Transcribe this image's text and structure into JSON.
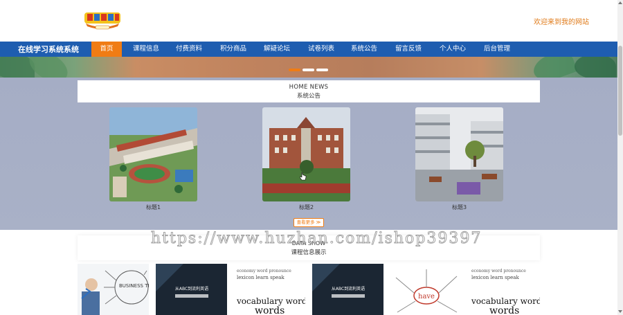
{
  "header": {
    "welcome": "欢迎来到我的网站"
  },
  "nav": {
    "brand": "在线学习系统系统",
    "items": [
      "首页",
      "课程信息",
      "付费资料",
      "积分商品",
      "解疑论坛",
      "试卷列表",
      "系统公告",
      "留言反馈",
      "个人中心",
      "后台管理"
    ],
    "active_index": 0
  },
  "banner": {
    "slides": 3,
    "active_slide": 0
  },
  "news": {
    "title_en": "HOME NEWS",
    "title_cn": "系统公告",
    "cards": [
      {
        "caption": "标题1"
      },
      {
        "caption": "标题2"
      },
      {
        "caption": "标题3"
      }
    ],
    "more": "查看更多 ≫"
  },
  "courses": {
    "title_en": "DATA SHOW",
    "title_cn": "课程信息展示",
    "thumbs": [
      "BUSINESS TRAINING",
      "从ABC到流利英语",
      "vocabulary words",
      "从ABC到流利英语",
      "have",
      "vocabulary words"
    ]
  },
  "watermark": "https://www.huzhan.com/ishop39397",
  "colors": {
    "nav": "#1e5db0",
    "accent": "#f07c14"
  }
}
